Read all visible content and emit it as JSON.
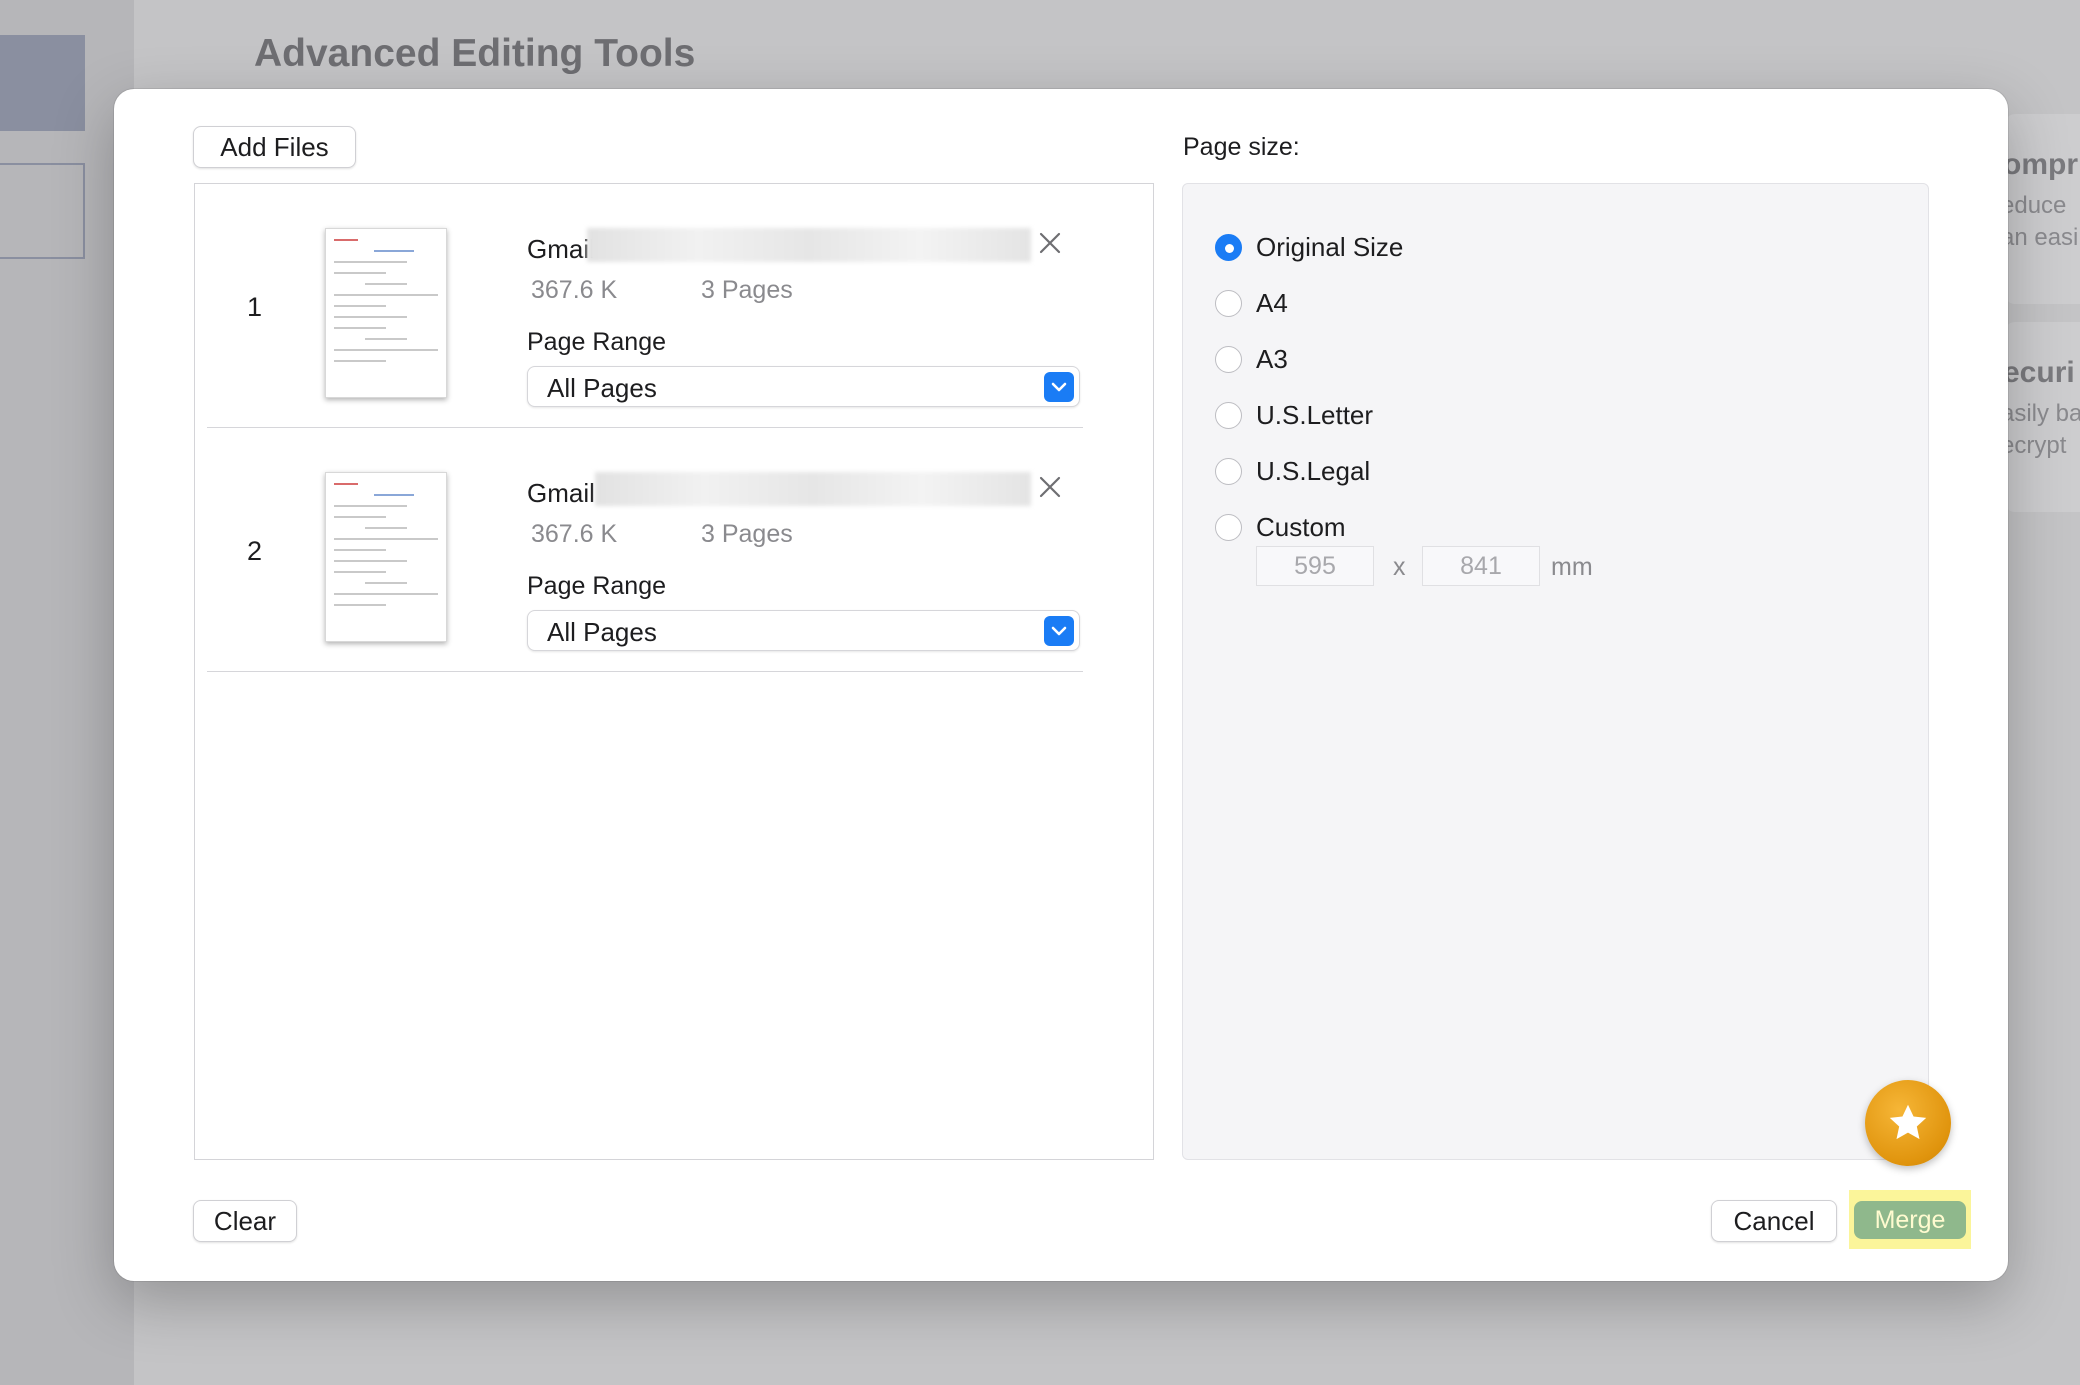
{
  "background": {
    "title": "Advanced Editing Tools",
    "cards": [
      {
        "heading": "ompr",
        "lines": [
          "educe",
          "an easi"
        ]
      },
      {
        "heading": "ecuri",
        "lines": [
          "asily ba",
          "ecrypt"
        ]
      }
    ]
  },
  "dialog": {
    "add_files_label": "Add Files",
    "files": [
      {
        "index": "1",
        "name": "Gmail -",
        "size": "367.6 K",
        "pages": "3 Pages",
        "range_label": "Page Range",
        "range_value": "All Pages"
      },
      {
        "index": "2",
        "name": "Gmail -",
        "size": "367.6 K",
        "pages": "3 Pages",
        "range_label": "Page Range",
        "range_value": "All Pages"
      }
    ],
    "page_size": {
      "label": "Page size:",
      "options": [
        "Original Size",
        "A4",
        "A3",
        "U.S.Letter",
        "U.S.Legal",
        "Custom"
      ],
      "selected": "Original Size",
      "custom_width": "595",
      "custom_height": "841",
      "separator": "x",
      "unit": "mm"
    },
    "clear_label": "Clear",
    "cancel_label": "Cancel",
    "merge_label": "Merge"
  },
  "colors": {
    "accent": "#1a7cf5",
    "merge_button": "#8fb88c",
    "highlight": "#fbf59a",
    "badge": "#e0940d"
  },
  "icons": {
    "close": "close-icon",
    "select_arrow": "chevron-down-icon",
    "badge": "star-icon"
  }
}
